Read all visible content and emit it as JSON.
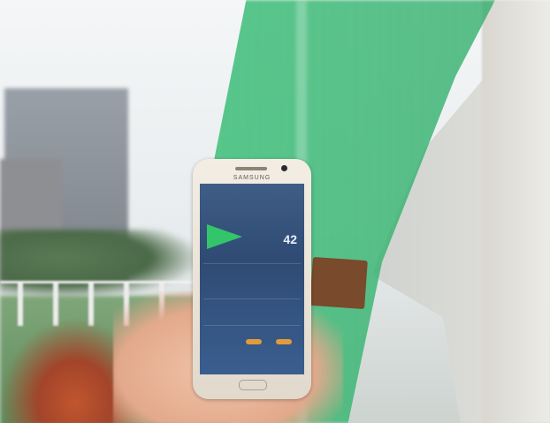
{
  "photo": {
    "description_icons": {
      "phone": "smartphone",
      "mesh": "shade-net"
    },
    "phone_brand": "SAMSUNG",
    "uv_value": "42"
  }
}
